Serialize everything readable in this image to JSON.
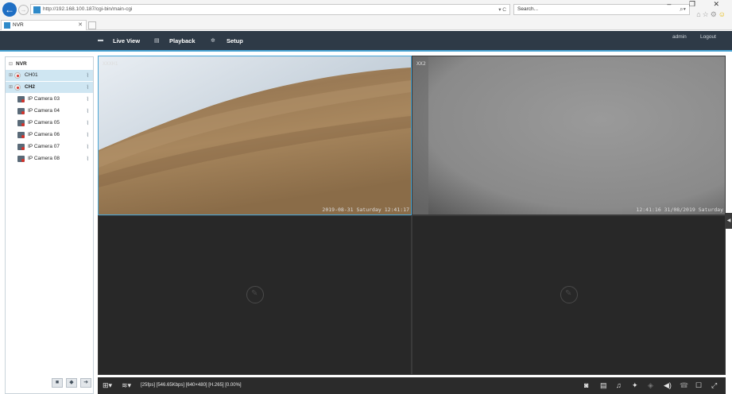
{
  "browser": {
    "url": "http://192.168.100.187/cgi-bin/main-cgi",
    "url_controls": "▾ C",
    "search_placeholder": "Search...",
    "tab_title": "NVR",
    "window_controls": "– ❐ ✕"
  },
  "header": {
    "nav": [
      {
        "label": "Live View",
        "icon": "monitor-icon"
      },
      {
        "label": "Playback",
        "icon": "film-icon"
      },
      {
        "label": "Setup",
        "icon": "gear-icon"
      }
    ],
    "user": "admin",
    "logout_label": "Logout"
  },
  "sidebar": {
    "root_label": "NVR",
    "items": [
      {
        "label": "CH01",
        "selected": true,
        "type": "channel"
      },
      {
        "label": "CH2",
        "selected": true,
        "type": "channel"
      },
      {
        "label": "IP Camera 03",
        "selected": false,
        "type": "camera"
      },
      {
        "label": "IP Camera 04",
        "selected": false,
        "type": "camera"
      },
      {
        "label": "IP Camera 05",
        "selected": false,
        "type": "camera"
      },
      {
        "label": "IP Camera 06",
        "selected": false,
        "type": "camera"
      },
      {
        "label": "IP Camera 07",
        "selected": false,
        "type": "camera"
      },
      {
        "label": "IP Camera 08",
        "selected": false,
        "type": "camera"
      }
    ],
    "buttons": [
      "stop-icon",
      "prev-icon",
      "next-icon"
    ]
  },
  "grid": {
    "tiles": [
      {
        "name_osd": "XXXH1",
        "time_osd": "2019-08-31 Saturday 12:41:17",
        "active": true,
        "has_video": true
      },
      {
        "name_osd": "XX2",
        "time_osd": "12:41:16 31/08/2019 Saturday",
        "active": false,
        "has_video": true
      },
      {
        "name_osd": "",
        "time_osd": "",
        "active": false,
        "has_video": false
      },
      {
        "name_osd": "",
        "time_osd": "",
        "active": false,
        "has_video": false
      }
    ]
  },
  "toolbar": {
    "stream_info": "[25fps] [546.65Kbps] [640×480] [H.265] [0.00%]",
    "left_icons": [
      "layout-grid-icon",
      "stream-type-icon"
    ],
    "right_icons": [
      "snapshot-icon",
      "record-icon",
      "audio-icon",
      "ptz-icon",
      "zoom-icon",
      "volume-icon",
      "talk-icon",
      "image-settings-icon",
      "fullscreen-icon"
    ]
  }
}
